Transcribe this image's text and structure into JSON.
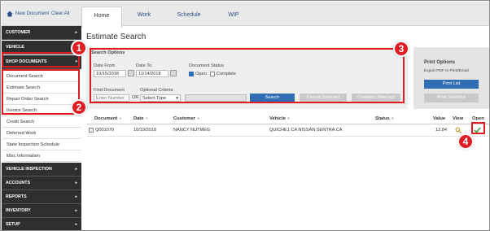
{
  "topbar": {
    "new_document": "New Document",
    "clear_all": "Clear All",
    "tabs": [
      "Home",
      "Work",
      "Schedule",
      "WIP"
    ]
  },
  "sidebar": {
    "top_items": [
      "CUSTOMER",
      "VEHICLE",
      "SHOP DOCUMENTS"
    ],
    "sub_items": [
      "Document Search",
      "Estimate Search",
      "Repair Order Search",
      "Invoice Search",
      "Credit Search",
      "Deferred Work",
      "State Inspection Schedule",
      "Misc Information"
    ],
    "bottom_items": [
      "VEHICLE INSPECTION",
      "ACCOUNTS",
      "REPORTS",
      "INVENTORY",
      "SETUP"
    ]
  },
  "main": {
    "title": "Estimate Search",
    "options": {
      "heading": "Search Options",
      "date_from_label": "Date From",
      "date_from_value": "10/15/2018",
      "date_to_label": "Date To",
      "date_to_value": "11/14/2018",
      "status_label": "Document Status",
      "open_label": "Open",
      "complete_label": "Complete",
      "find_label": "Find Document",
      "find_placeholder": "Enter Number",
      "or_label": "OR",
      "criteria_label": "Optional Criteria",
      "criteria_value": "Select Type",
      "search_button": "Search",
      "cancel_button": "Cancel Selected",
      "combine_button": "Combine Selected"
    },
    "print": {
      "heading": "Print Options",
      "subtext": "Export PDF to Print/Email",
      "print_list": "Print List",
      "print_selected": "Print Selected"
    },
    "grid": {
      "headers": [
        "Document",
        "Date",
        "Customer",
        "Vehicle",
        "Status",
        "Value",
        "View",
        "Open"
      ],
      "row": {
        "document": "Q001070",
        "date": "10/19/2018",
        "customer": "NANCY NUTMEG",
        "vehicle": "QUICHE1 CA NISSAN SENTRA CA",
        "status": "",
        "value": "12.84"
      }
    }
  },
  "callouts": [
    "1",
    "2",
    "3",
    "4"
  ],
  "colors": {
    "accent": "#2f6db5",
    "callout": "#e01b22",
    "sidebar": "#2f2f2f"
  }
}
